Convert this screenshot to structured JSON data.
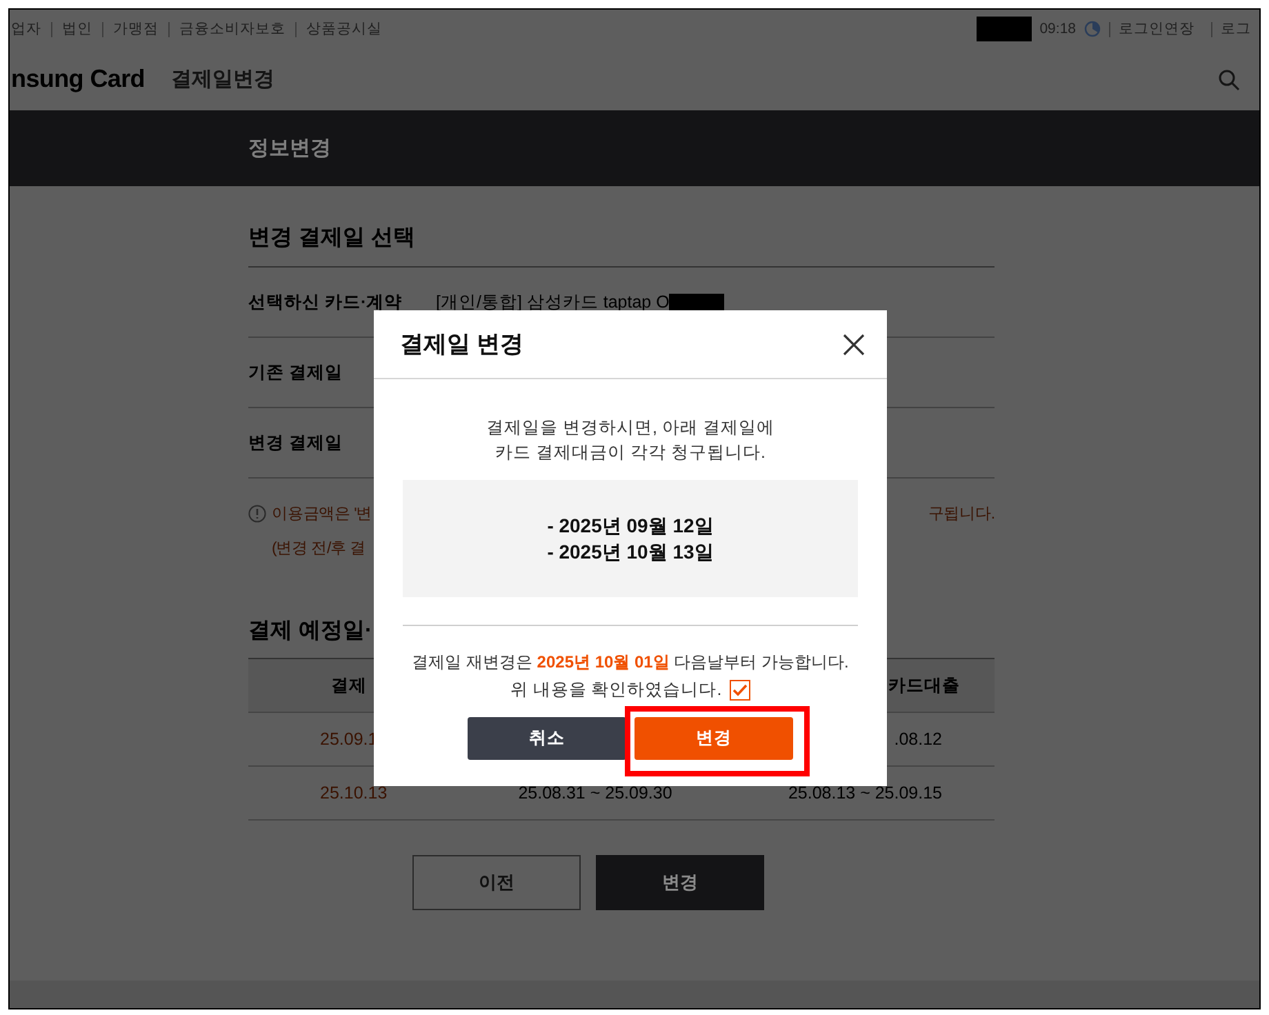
{
  "top_links": [
    "업자",
    "법인",
    "가맹점",
    "금융소비자보호",
    "상품공시실"
  ],
  "top_right": {
    "time": "09:18",
    "links": [
      "로그인연장",
      "로그"
    ]
  },
  "header": {
    "logo": "nsung Card",
    "title": "결제일변경"
  },
  "page_bar": {
    "title": "정보변경"
  },
  "section": {
    "title": "변경 결제일 선택",
    "rows": [
      {
        "label": "선택하신 카드·계약",
        "value": "[개인/통합] 삼성카드 taptap O"
      },
      {
        "label": "기존 결제일"
      },
      {
        "label": "변경 결제일"
      }
    ]
  },
  "notice": [
    {
      "left": "이용금액은 '변",
      "right": "구됩니다."
    },
    {
      "left": "(변경 전/후 결"
    }
  ],
  "schedule": {
    "title": "결제 예정일·",
    "columns": {
      "column_1": "결제",
      "column_3": "카드대출"
    },
    "rows": [
      {
        "column_1": "25.09.1",
        "column_3": ".08.12"
      },
      {
        "column_1": "25.10.13",
        "column_2": "25.08.31 ~ 25.09.30",
        "column_3": "25.08.13 ~ 25.09.15"
      }
    ]
  },
  "buttons": [
    {
      "label": "이전",
      "kind": "outline"
    },
    {
      "label": "변경",
      "kind": "dark"
    }
  ],
  "modal": {
    "title": "결제일 변경",
    "message": [
      "결제일을 변경하시면, 아래 결제일에",
      "카드 결제대금이 각각 청구됩니다."
    ],
    "dates": [
      "- 2025년 09월 12일",
      "- 2025년 10월 13일"
    ],
    "notice": "결제일 재변경은 **2025년 10월 01일** 다음날부터 가능합니다.",
    "confirm": {
      "label": "위 내용을 확인하였습니다.",
      "checked": true
    },
    "buttons": [
      {
        "label": "취소",
        "kind": "secondary",
        "highlighted": false
      },
      {
        "label": "변경",
        "kind": "primary",
        "highlighted": true
      }
    ]
  }
}
